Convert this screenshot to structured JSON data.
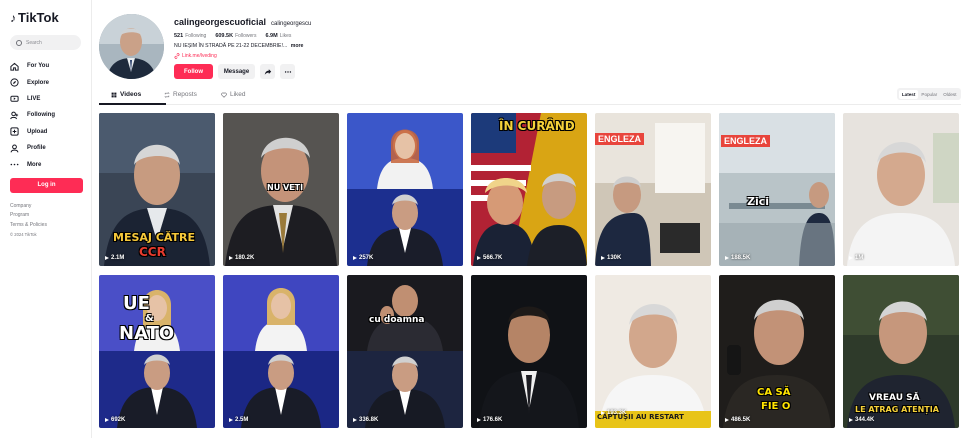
{
  "sidebar": {
    "logo": "TikTok",
    "search_placeholder": "Search",
    "nav": [
      {
        "label": "For You",
        "icon": "home-icon"
      },
      {
        "label": "Explore",
        "icon": "compass-icon"
      },
      {
        "label": "LIVE",
        "icon": "live-icon"
      },
      {
        "label": "Following",
        "icon": "following-icon"
      },
      {
        "label": "Upload",
        "icon": "upload-icon"
      },
      {
        "label": "Profile",
        "icon": "profile-icon"
      },
      {
        "label": "More",
        "icon": "more-icon"
      }
    ],
    "login": "Log in",
    "footer": [
      "Company",
      "Program",
      "Terms & Policies"
    ],
    "copyright": "© 2024 TikTok"
  },
  "profile": {
    "username": "calingeorgescuoficial",
    "nickname": "calingeorgescu",
    "following_count": "521",
    "following_label": "Following",
    "followers_count": "609.5K",
    "followers_label": "Followers",
    "likes_count": "6.9M",
    "likes_label": "Likes",
    "bio": "NU IEȘIM ÎN STRADĂ PE 21-22 DECEMBRIE!...",
    "bio_more": "more",
    "link": "Link.me/lveding",
    "follow_button": "Follow",
    "message_button": "Message"
  },
  "tabs": [
    {
      "label": "Videos",
      "icon": "grid-icon"
    },
    {
      "label": "Reposts",
      "icon": "repost-icon"
    },
    {
      "label": "Liked",
      "icon": "heart-icon"
    }
  ],
  "sort": [
    "Latest",
    "Popular",
    "Oldest"
  ],
  "videos": [
    {
      "views": "2.1M",
      "overlay": "MESAJ CĂTRE",
      "overlay2": "CCR"
    },
    {
      "views": "180.2K",
      "overlay": "NU VETI"
    },
    {
      "views": "257K"
    },
    {
      "views": "566.7K",
      "overlay": "ÎN CURÂND"
    },
    {
      "views": "130K",
      "tag": "ENGLEZA"
    },
    {
      "views": "188.5K",
      "tag": "ENGLEZA",
      "overlay": "Zici"
    },
    {
      "views": "1M"
    },
    {
      "views": "692K",
      "overlay": "UE",
      "overlay2": "&",
      "overlay3": "NATO"
    },
    {
      "views": "2.5M"
    },
    {
      "views": "336.8K",
      "overlay": "cu doamna"
    },
    {
      "views": "176.6K"
    },
    {
      "views": "193.3K",
      "overlay": "CĂPTUȘII AU RESTART"
    },
    {
      "views": "486.5K",
      "overlay": "CA SĂ",
      "overlay2": "FIE O"
    },
    {
      "views": "344.4K",
      "overlay": "VREAU SĂ",
      "overlay2": "LE ATRAG ATENȚIA"
    }
  ],
  "colors": {
    "accent": "#fe2c55",
    "text": "#161823",
    "muted": "#75767c"
  }
}
